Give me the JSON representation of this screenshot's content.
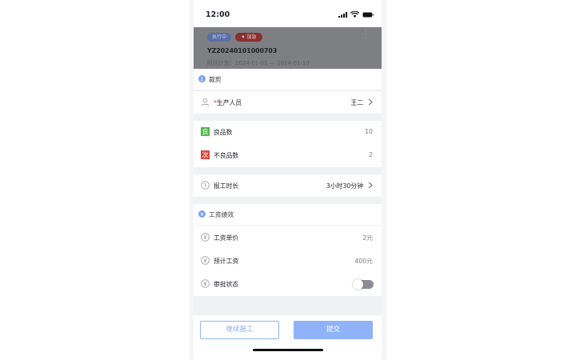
{
  "status_bar": {
    "time": "12:00"
  },
  "order": {
    "status_chip": "执行中",
    "urgent_chip": "加急",
    "order_no": "YZ20240101000703",
    "plan_time": "时间计划：2024-01-01 — 2024-01-10"
  },
  "process": {
    "title": "裁剪"
  },
  "producer": {
    "label": "生产人员",
    "required_mark": "*",
    "value": "王二"
  },
  "quantities": {
    "good_label": "良品数",
    "good_value": "10",
    "good_badge": "良",
    "bad_label": "不良品数",
    "bad_value": "2",
    "bad_badge": "次"
  },
  "duration": {
    "label": "报工时长",
    "value": "3小时30分钟"
  },
  "wage": {
    "title": "工资绩效",
    "unit_price_label": "工资单价",
    "unit_price_value": "2元",
    "estimated_label": "预计工资",
    "estimated_value": "400元",
    "approval_label": "审批状态",
    "approval_on": false
  },
  "actions": {
    "continue_label": "继续报工",
    "submit_label": "提交"
  },
  "colors": {
    "accent": "#8fb2f8",
    "good_badge": "#4fb64a",
    "bad_badge": "#d9473c",
    "required": "#e23a3a"
  }
}
